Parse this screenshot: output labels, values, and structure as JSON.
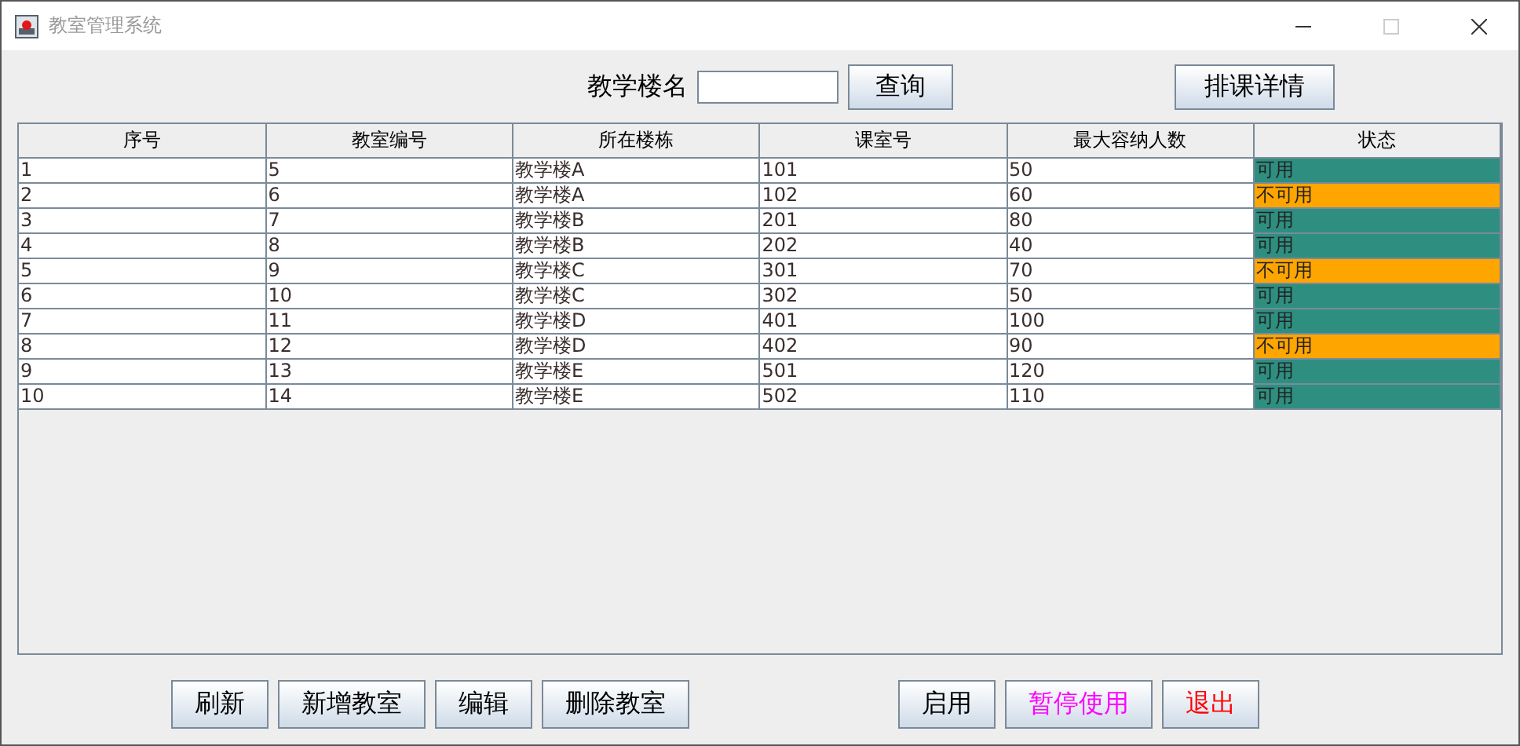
{
  "window": {
    "title": "教室管理系统"
  },
  "search": {
    "label": "教学楼名",
    "query_button": "查询",
    "schedule_button": "排课详情"
  },
  "table": {
    "columns": [
      "序号",
      "教室编号",
      "所在楼栋",
      "课室号",
      "最大容纳人数",
      "状态"
    ],
    "rows": [
      {
        "cells": [
          "1",
          "5",
          "教学楼A",
          "101",
          "50"
        ],
        "status": "可用",
        "color": "#2e8f80"
      },
      {
        "cells": [
          "2",
          "6",
          "教学楼A",
          "102",
          "60"
        ],
        "status": "不可用",
        "color": "#ffa500"
      },
      {
        "cells": [
          "3",
          "7",
          "教学楼B",
          "201",
          "80"
        ],
        "status": "可用",
        "color": "#2e8f80"
      },
      {
        "cells": [
          "4",
          "8",
          "教学楼B",
          "202",
          "40"
        ],
        "status": "可用",
        "color": "#2e8f80"
      },
      {
        "cells": [
          "5",
          "9",
          "教学楼C",
          "301",
          "70"
        ],
        "status": "不可用",
        "color": "#ffa500"
      },
      {
        "cells": [
          "6",
          "10",
          "教学楼C",
          "302",
          "50"
        ],
        "status": "可用",
        "color": "#2e8f80"
      },
      {
        "cells": [
          "7",
          "11",
          "教学楼D",
          "401",
          "100"
        ],
        "status": "可用",
        "color": "#2e8f80"
      },
      {
        "cells": [
          "8",
          "12",
          "教学楼D",
          "402",
          "90"
        ],
        "status": "不可用",
        "color": "#ffa500"
      },
      {
        "cells": [
          "9",
          "13",
          "教学楼E",
          "501",
          "120"
        ],
        "status": "可用",
        "color": "#2e8f80"
      },
      {
        "cells": [
          "10",
          "14",
          "教学楼E",
          "502",
          "110"
        ],
        "status": "可用",
        "color": "#2e8f80"
      }
    ]
  },
  "left_buttons": [
    {
      "label": "刷新",
      "color": "#000000"
    },
    {
      "label": "新增教室",
      "color": "#000000"
    },
    {
      "label": "编辑",
      "color": "#000000"
    },
    {
      "label": "删除教室",
      "color": "#000000"
    }
  ],
  "right_buttons": [
    {
      "label": "启用",
      "color": "#000000"
    },
    {
      "label": "暂停使用",
      "color": "#ff00ff"
    },
    {
      "label": "退出",
      "color": "#ff0000"
    }
  ]
}
